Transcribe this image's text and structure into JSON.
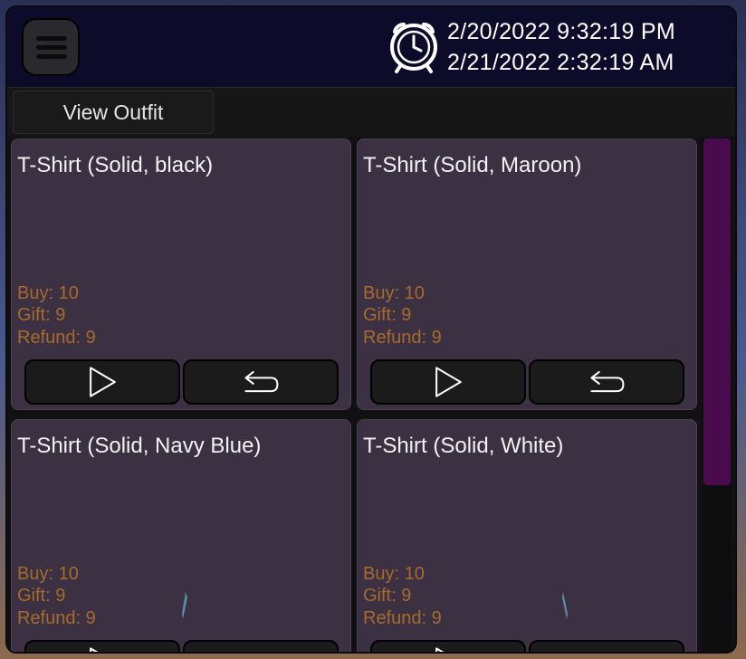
{
  "header": {
    "menu_icon": "hamburger-menu-icon",
    "clock_icon": "alarm-clock-icon",
    "date_primary": "2/20/2022 9:32:19 PM",
    "date_secondary": "2/21/2022 2:32:19 AM"
  },
  "toolbar": {
    "view_outfit_label": "View Outfit"
  },
  "items": [
    {
      "title": "T-Shirt (Solid, black)",
      "buy": "Buy: 10",
      "gift": "Gift: 9",
      "refund": "Refund: 9"
    },
    {
      "title": "T-Shirt (Solid, Maroon)",
      "buy": "Buy: 10",
      "gift": "Gift: 9",
      "refund": "Refund: 9"
    },
    {
      "title": "T-Shirt (Solid, Navy Blue)",
      "buy": "Buy: 10",
      "gift": "Gift: 9",
      "refund": "Refund: 9"
    },
    {
      "title": "T-Shirt (Solid, White)",
      "buy": "Buy: 10",
      "gift": "Gift: 9",
      "refund": "Refund: 9"
    }
  ],
  "buttons": {
    "buy_icon": "play-triangle-icon",
    "refund_icon": "return-arrow-icon"
  },
  "colors": {
    "panel": "#111114",
    "header": "#0c0c2a",
    "card": "#3b3143",
    "stat_text": "#a86a2c",
    "scroll_thumb": "#4a0a4e"
  }
}
